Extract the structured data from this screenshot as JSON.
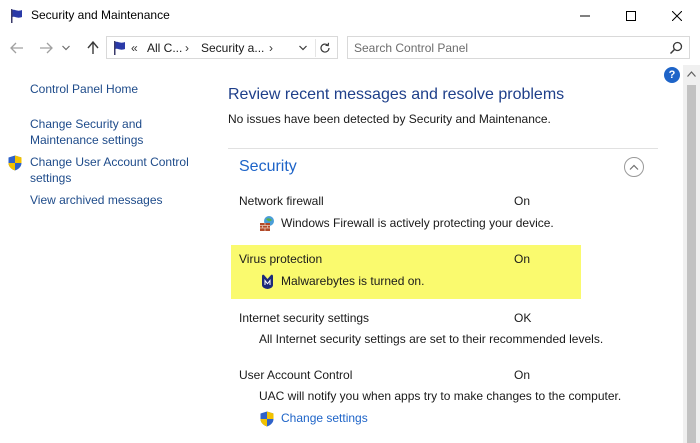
{
  "window": {
    "title": "Security and Maintenance",
    "controls": [
      "minimize-icon",
      "maximize-icon",
      "close-icon"
    ]
  },
  "navigation": {
    "breadcrumb_overflow": "«",
    "breadcrumbs": [
      "All C...",
      "Security a..."
    ],
    "breadcrumb_separator": "›",
    "search_placeholder": "Search Control Panel"
  },
  "sidebar": {
    "items": [
      {
        "label": "Control Panel Home"
      },
      {
        "label": "Change Security and Maintenance settings"
      },
      {
        "label": "Change User Account Control settings",
        "icon": "uac-shield-icon"
      },
      {
        "label": "View archived messages"
      }
    ]
  },
  "main": {
    "heading": "Review recent messages and resolve problems",
    "subtext": "No issues have been detected by Security and Maintenance.",
    "section_title": "Security",
    "rows": [
      {
        "label": "Network firewall",
        "status": "On",
        "description": "Windows Firewall is actively protecting your device.",
        "icon": "firewall-icon"
      },
      {
        "label": "Virus protection",
        "status": "On",
        "description": "Malwarebytes is turned on.",
        "icon": "malwarebytes-icon",
        "highlighted": true
      },
      {
        "label": "Internet security settings",
        "status": "OK",
        "description": "All Internet security settings are set to their recommended levels."
      },
      {
        "label": "User Account Control",
        "status": "On",
        "description": "UAC will notify you when apps try to make changes to the computer.",
        "link": "Change settings"
      }
    ]
  },
  "colors": {
    "link": "#1e4b8a",
    "heading": "#1e3f8a",
    "section_heading": "#1e64c8",
    "highlight": "#fafa6e"
  }
}
